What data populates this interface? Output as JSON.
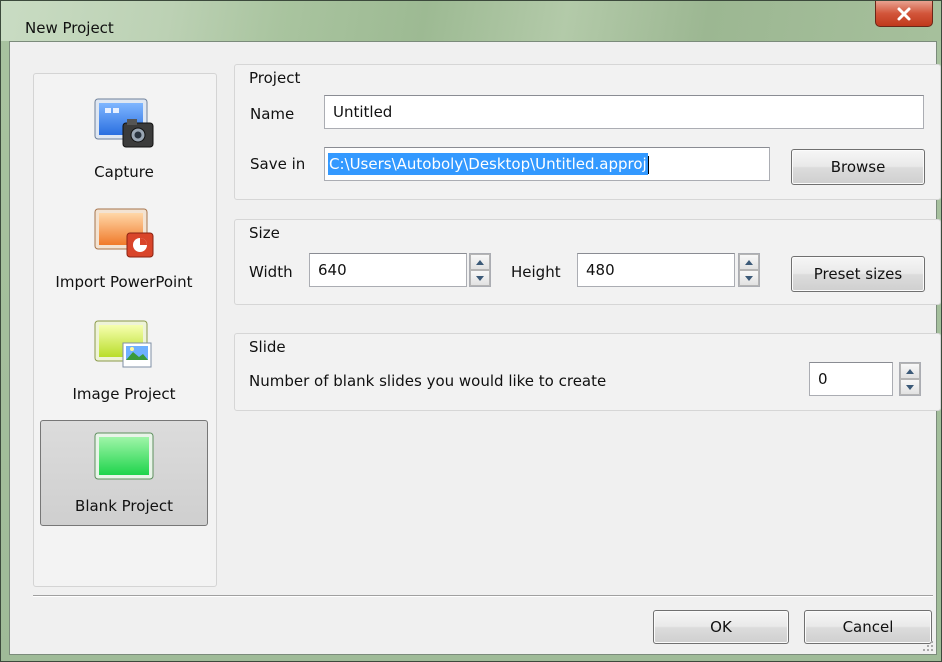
{
  "window": {
    "title": "New Project"
  },
  "project_types": [
    {
      "label": "Capture",
      "icon": "camera-capture-icon",
      "selected": false
    },
    {
      "label": "Import PowerPoint",
      "icon": "powerpoint-icon",
      "selected": false
    },
    {
      "label": "Image Project",
      "icon": "image-project-icon",
      "selected": false
    },
    {
      "label": "Blank Project",
      "icon": "blank-project-icon",
      "selected": true
    }
  ],
  "project_group": {
    "title": "Project",
    "name_label": "Name",
    "name_value": "Untitled",
    "save_in_label": "Save in",
    "save_in_value": "C:\\Users\\Autoboly\\Desktop\\Untitled.approj",
    "browse_label": "Browse"
  },
  "size_group": {
    "title": "Size",
    "width_label": "Width",
    "width_value": "640",
    "height_label": "Height",
    "height_value": "480",
    "preset_label": "Preset sizes"
  },
  "slide_group": {
    "title": "Slide",
    "blank_slides_label": "Number of blank slides you would like to create",
    "blank_slides_value": "0"
  },
  "footer": {
    "ok_label": "OK",
    "cancel_label": "Cancel"
  },
  "colors": {
    "selection": "#3399ff",
    "close_button": "#c8452a",
    "blank_project_green": "#22dd55"
  }
}
